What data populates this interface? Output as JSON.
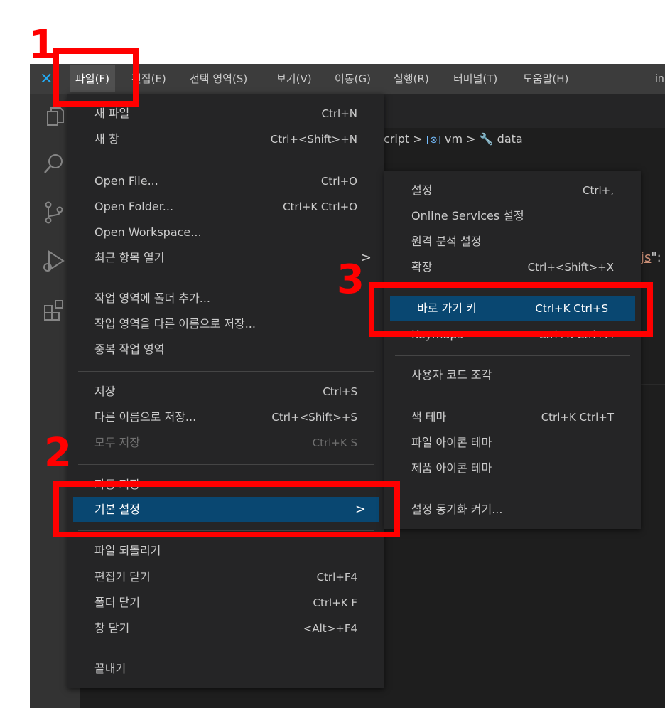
{
  "menubar": {
    "items": [
      "파일(F)",
      "편집(E)",
      "선택 영역(S)",
      "보기(V)",
      "이동(G)",
      "실행(R)",
      "터미널(T)",
      "도움말(H)"
    ],
    "title_fragment": "in"
  },
  "breadcrumb": {
    "lead": "cript",
    "sep": ">",
    "vm": "vm",
    "data": "data"
  },
  "code_fragment": {
    "text": "js",
    "after": "\":"
  },
  "file_menu": {
    "new_file": {
      "label": "새 파일",
      "shortcut": "Ctrl+N"
    },
    "new_window": {
      "label": "새 창",
      "shortcut": "Ctrl+<Shift>+N"
    },
    "open_file": {
      "label": "Open File...",
      "shortcut": "Ctrl+O"
    },
    "open_folder": {
      "label": "Open Folder...",
      "shortcut": "Ctrl+K Ctrl+O"
    },
    "open_workspace": {
      "label": "Open Workspace..."
    },
    "open_recent": {
      "label": "최근 항목 열기",
      "arrow": ">"
    },
    "add_folder": {
      "label": "작업 영역에 폴더 추가..."
    },
    "save_workspace_as": {
      "label": "작업 영역을 다른 이름으로 저장..."
    },
    "duplicate_workspace": {
      "label": "중복 작업 영역"
    },
    "save": {
      "label": "저장",
      "shortcut": "Ctrl+S"
    },
    "save_as": {
      "label": "다른 이름으로 저장...",
      "shortcut": "Ctrl+<Shift>+S"
    },
    "save_all": {
      "label": "모두 저장",
      "shortcut": "Ctrl+K S"
    },
    "auto_save": {
      "label": "자동 저장"
    },
    "preferences": {
      "label": "기본 설정",
      "arrow": ">"
    },
    "revert": {
      "label": "파일 되돌리기"
    },
    "close_editor": {
      "label": "편집기 닫기",
      "shortcut": "Ctrl+F4"
    },
    "close_folder": {
      "label": "폴더 닫기",
      "shortcut": "Ctrl+K F"
    },
    "close_window": {
      "label": "창 닫기",
      "shortcut": "<Alt>+F4"
    },
    "exit": {
      "label": "끝내기"
    }
  },
  "pref_menu": {
    "settings": {
      "label": "설정",
      "shortcut": "Ctrl+,"
    },
    "online_services": {
      "label": "Online Services 설정"
    },
    "telemetry": {
      "label": "원격 분석 설정"
    },
    "extensions": {
      "label": "확장",
      "shortcut": "Ctrl+<Shift>+X"
    },
    "keyboard_shortcuts": {
      "label": "바로 가기 키",
      "shortcut": "Ctrl+K Ctrl+S"
    },
    "keymaps": {
      "label": "Keymaps",
      "shortcut": "Ctrl+K Ctrl+M"
    },
    "user_snippets": {
      "label": "사용자 코드 조각"
    },
    "color_theme": {
      "label": "색 테마",
      "shortcut": "Ctrl+K Ctrl+T"
    },
    "file_icon_theme": {
      "label": "파일 아이콘 테마"
    },
    "product_icon_theme": {
      "label": "제품 아이콘 테마"
    },
    "settings_sync": {
      "label": "설정 동기화 켜기..."
    }
  },
  "annotations": {
    "step1": "1",
    "step2": "2",
    "step3": "3",
    "color": "#ff0000"
  },
  "colors": {
    "menu_bg": "#252526",
    "selection": "#094771",
    "titlebar": "#3c3c3c",
    "accent": "#23a9f2"
  }
}
